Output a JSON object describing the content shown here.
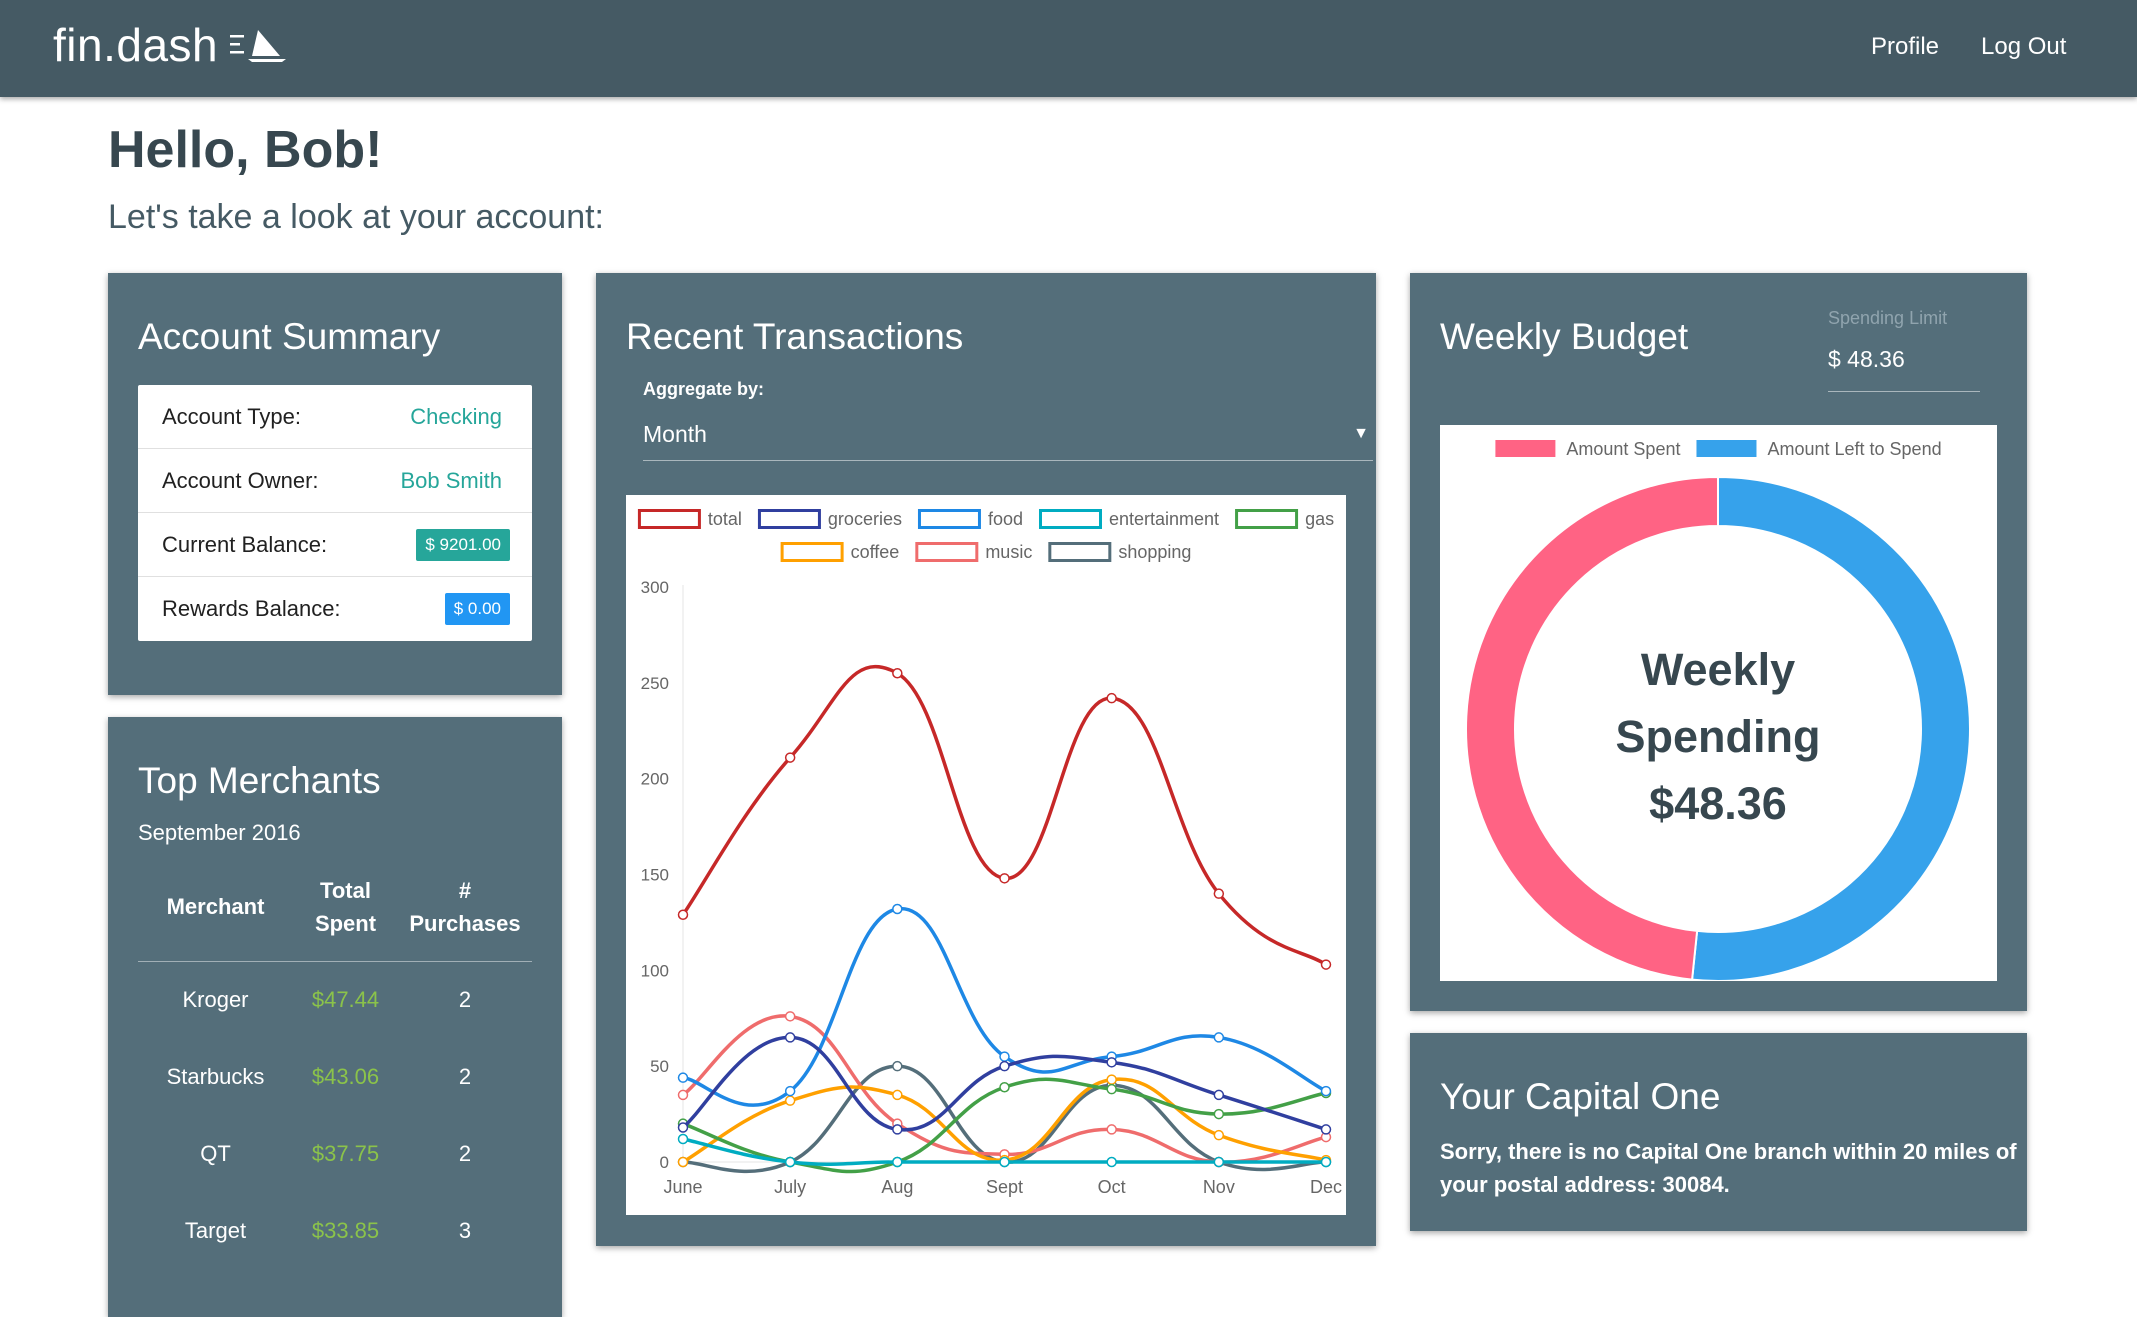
{
  "nav": {
    "brand": "fin.dash",
    "profile": "Profile",
    "logout": "Log Out"
  },
  "header": {
    "greeting": "Hello, Bob!",
    "subtitle": "Let's take a look at your account:"
  },
  "summary": {
    "title": "Account Summary",
    "rows": [
      {
        "label": "Account Type:",
        "value": "Checking"
      },
      {
        "label": "Account Owner:",
        "value": "Bob Smith"
      },
      {
        "label": "Current Balance:",
        "value": "$ 9201.00"
      },
      {
        "label": "Rewards Balance:",
        "value": "$ 0.00"
      }
    ]
  },
  "merchants": {
    "title": "Top Merchants",
    "period": "September 2016",
    "headers": {
      "merchant": "Merchant",
      "total_1": "Total",
      "total_2": "Spent",
      "purchases_1": "#",
      "purchases_2": "Purchases"
    },
    "rows": [
      {
        "name": "Kroger",
        "spent": "$47.44",
        "count": "2"
      },
      {
        "name": "Starbucks",
        "spent": "$43.06",
        "count": "2"
      },
      {
        "name": "QT",
        "spent": "$37.75",
        "count": "2"
      },
      {
        "name": "Target",
        "spent": "$33.85",
        "count": "3"
      }
    ]
  },
  "transactions": {
    "title": "Recent Transactions",
    "aggregate_label": "Aggregate by:",
    "aggregate_value": "Month"
  },
  "budget": {
    "title": "Weekly Budget",
    "limit_label": "Spending Limit",
    "limit_value": "$ 48.36",
    "center_line1": "Weekly",
    "center_line2": "Spending",
    "center_amount": "$48.36"
  },
  "capital": {
    "title": "Your Capital One",
    "message": "Sorry, there is no Capital One branch within 20 miles of your postal address: 30084."
  },
  "colors": {
    "navbar": "#455a64",
    "card": "#546e7a",
    "checking_teal": "#26a69a",
    "money_green": "#8bc34a",
    "balance_badge": "#26a69a",
    "rewards_badge": "#2196f3",
    "spent": "#ff6384",
    "left": "#36a2eb"
  },
  "chart_data": [
    {
      "type": "line",
      "x": [
        "June",
        "July",
        "Aug",
        "Sept",
        "Oct",
        "Nov",
        "Dec"
      ],
      "ylim": [
        0,
        300
      ],
      "yticks": [
        0,
        50,
        100,
        150,
        200,
        250,
        300
      ],
      "series": [
        {
          "name": "total",
          "color": "#c62828",
          "values": [
            129,
            211,
            255,
            148,
            242,
            140,
            103
          ]
        },
        {
          "name": "groceries",
          "color": "#303f9f",
          "values": [
            18,
            65,
            17,
            50,
            52,
            35,
            17
          ]
        },
        {
          "name": "food",
          "color": "#1e88e5",
          "values": [
            44,
            37,
            132,
            55,
            55,
            65,
            37
          ]
        },
        {
          "name": "entertainment",
          "color": "#00acc1",
          "values": [
            12,
            0,
            0,
            0,
            0,
            0,
            0
          ]
        },
        {
          "name": "gas",
          "color": "#43a047",
          "values": [
            20,
            0,
            0,
            39,
            38,
            25,
            36
          ]
        },
        {
          "name": "coffee",
          "color": "#ffa000",
          "values": [
            0,
            32,
            35,
            1,
            43,
            14,
            1
          ]
        },
        {
          "name": "music",
          "color": "#ef6c6c",
          "values": [
            35,
            76,
            20,
            4,
            17,
            0,
            13
          ]
        },
        {
          "name": "shopping",
          "color": "#546e7a",
          "values": [
            0,
            0,
            50,
            0,
            40,
            0,
            0
          ]
        }
      ]
    },
    {
      "type": "pie",
      "labels": [
        "Amount Spent",
        "Amount Left to Spend"
      ],
      "values": [
        48.36,
        51.64
      ],
      "colors": [
        "#ff6384",
        "#36a2eb"
      ]
    }
  ]
}
